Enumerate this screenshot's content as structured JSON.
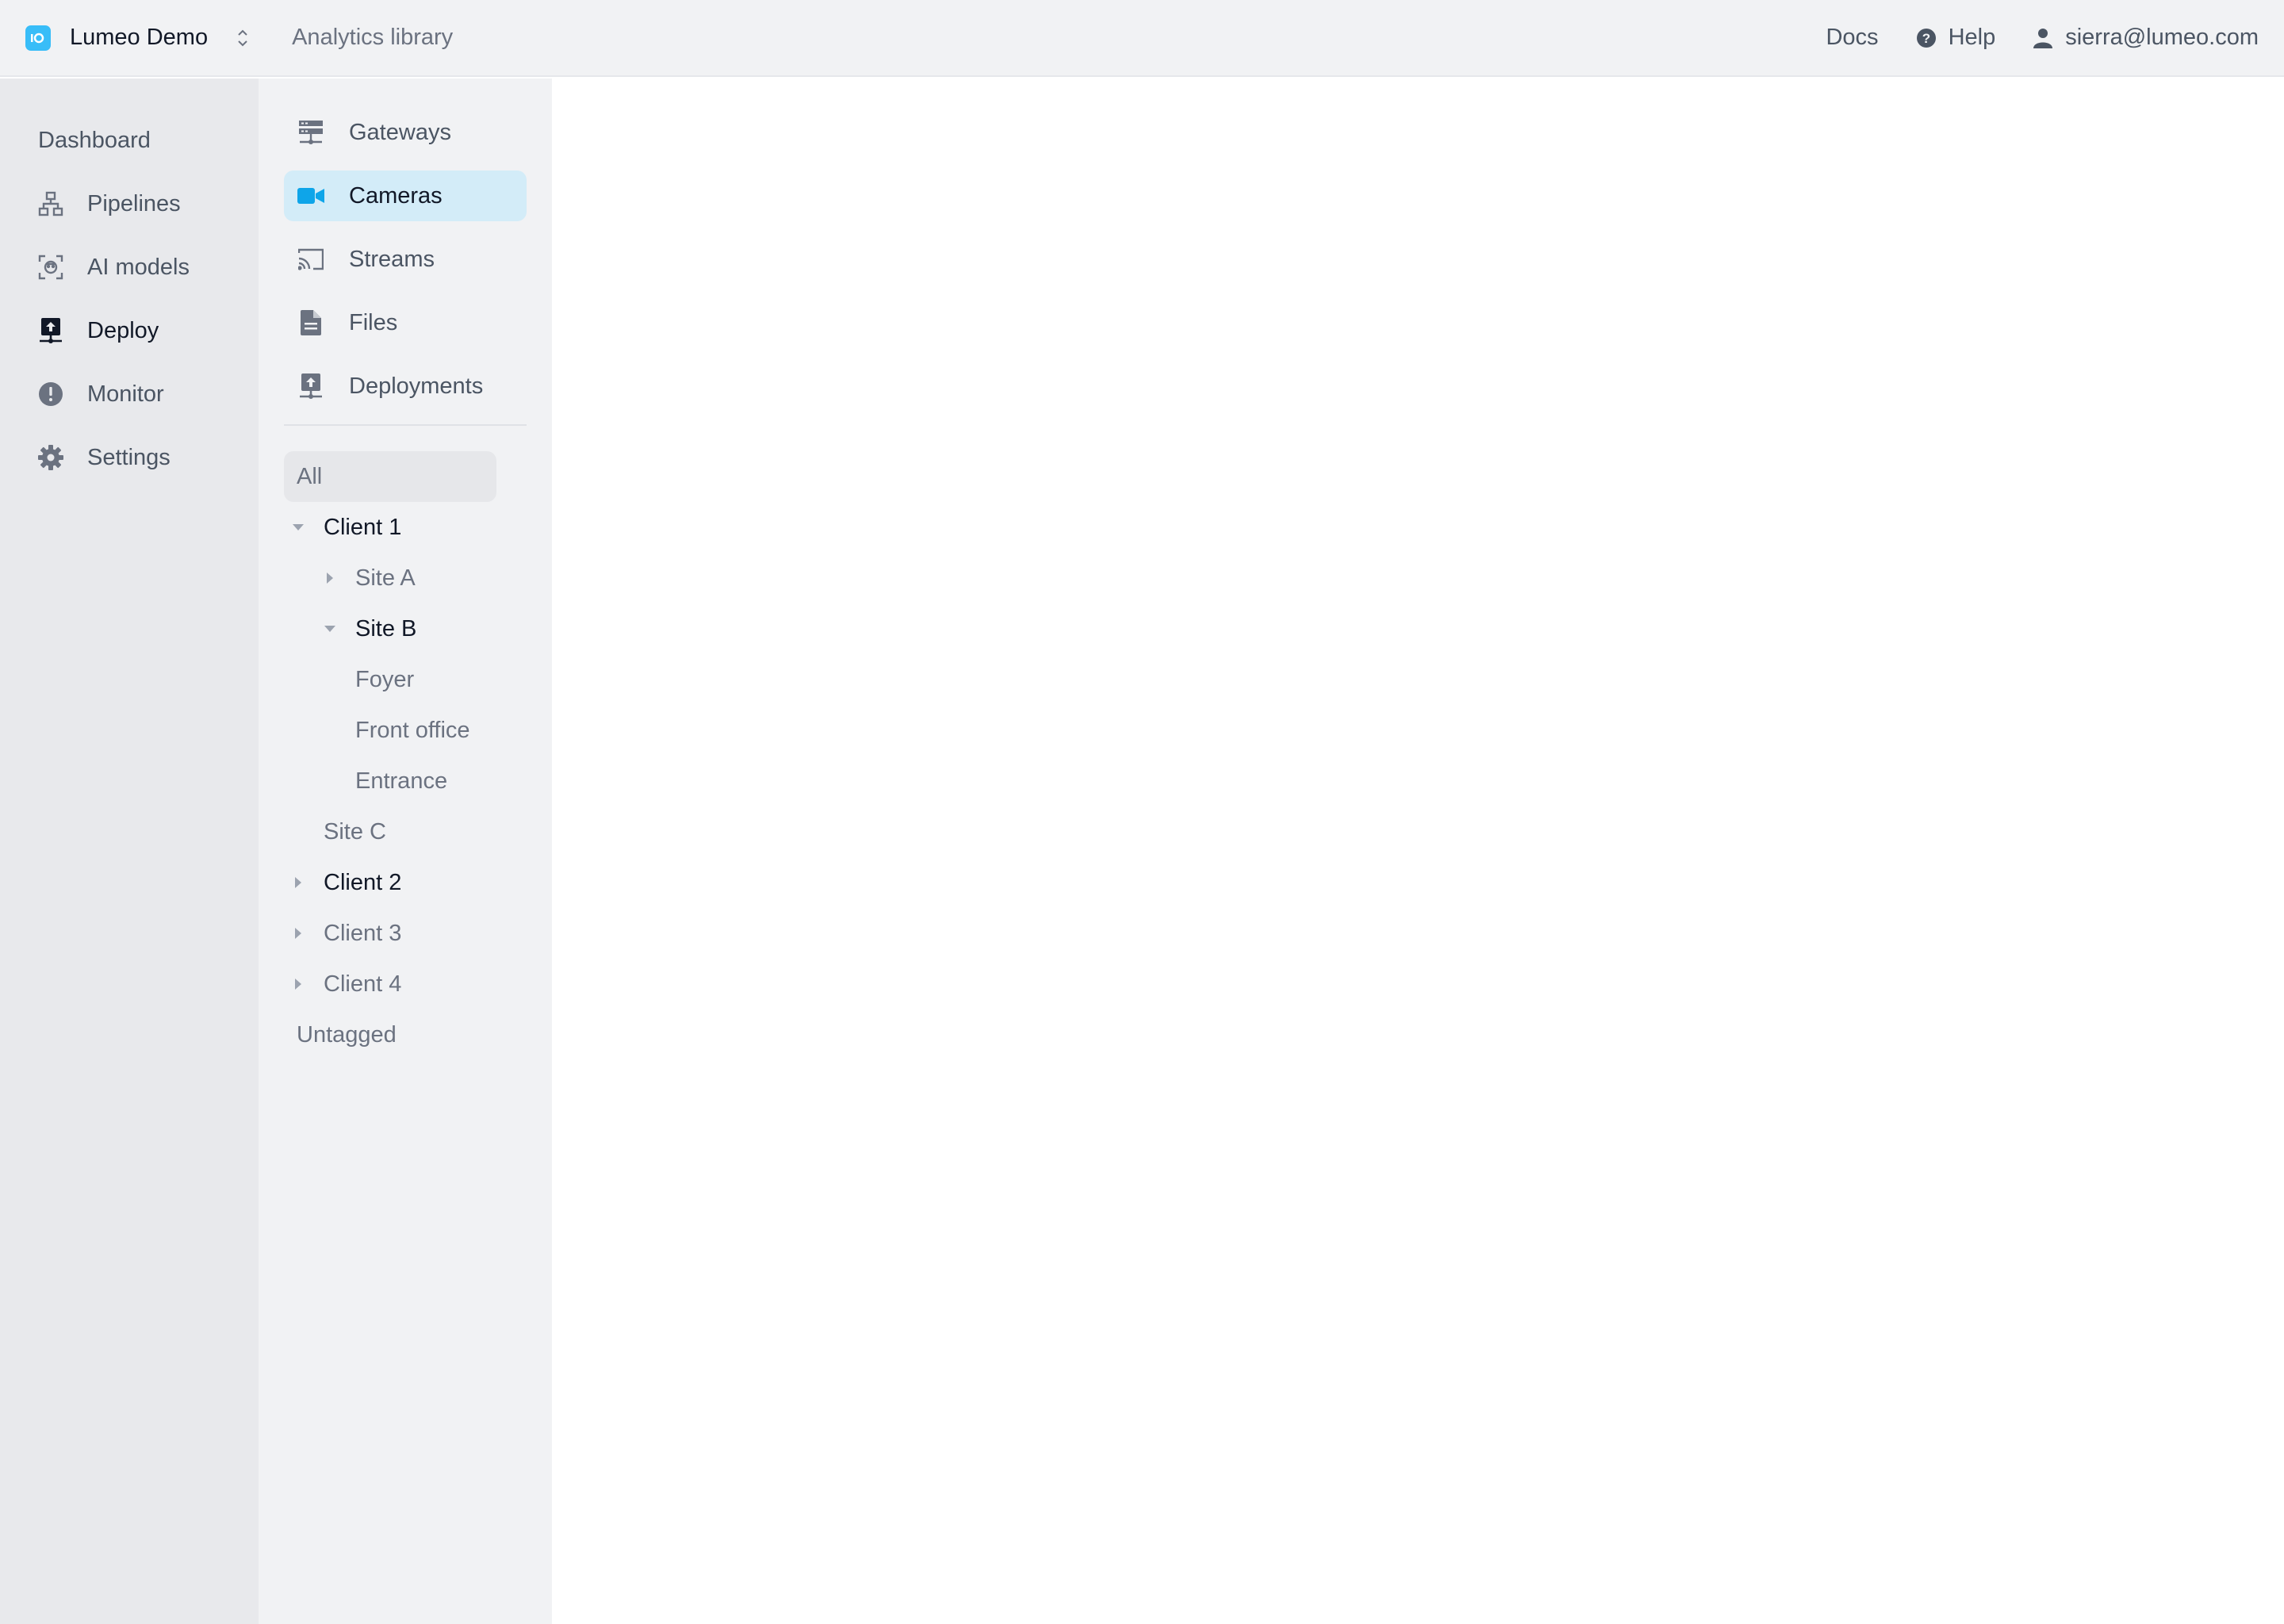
{
  "header": {
    "org_name": "Lumeo Demo",
    "analytics_label": "Analytics library",
    "docs_label": "Docs",
    "help_label": "Help",
    "user_email": "sierra@lumeo.com"
  },
  "sidebar": {
    "items": [
      {
        "label": "Dashboard",
        "icon": "none"
      },
      {
        "label": "Pipelines",
        "icon": "network-icon"
      },
      {
        "label": "AI models",
        "icon": "face-scan-icon"
      },
      {
        "label": "Deploy",
        "icon": "deploy-icon",
        "active": true
      },
      {
        "label": "Monitor",
        "icon": "alert-circle-icon"
      },
      {
        "label": "Settings",
        "icon": "gear-icon"
      }
    ]
  },
  "subnav": {
    "items": [
      {
        "label": "Gateways",
        "icon": "server-icon"
      },
      {
        "label": "Cameras",
        "icon": "video-camera-icon",
        "active": true
      },
      {
        "label": "Streams",
        "icon": "cast-icon"
      },
      {
        "label": "Files",
        "icon": "file-icon"
      },
      {
        "label": "Deployments",
        "icon": "deploy-icon"
      }
    ]
  },
  "tree": {
    "all": "All",
    "client1": "Client 1",
    "site_a": "Site A",
    "site_b": "Site B",
    "foyer": "Foyer",
    "front_office": "Front office",
    "entrance": "Entrance",
    "site_c": "Site C",
    "client2": "Client 2",
    "client3": "Client 3",
    "client4": "Client 4",
    "untagged": "Untagged"
  },
  "colors": {
    "accent": "#0ea5e9",
    "active_bg": "#d3ecf8",
    "sidebar_bg": "#e8e9ec",
    "subnav_bg": "#f1f2f4"
  }
}
